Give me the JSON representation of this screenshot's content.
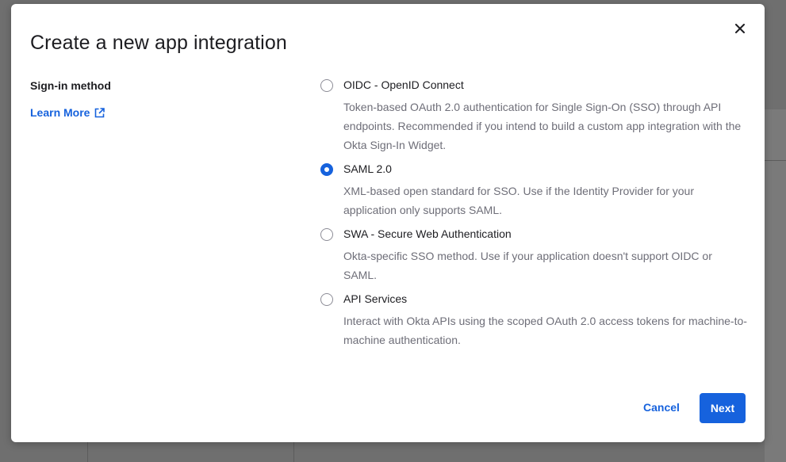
{
  "dialog": {
    "title": "Create a new app integration",
    "sign_in_label": "Sign-in method",
    "learn_more_label": "Learn More"
  },
  "options": [
    {
      "label": "OIDC - OpenID Connect",
      "description": "Token-based OAuth 2.0 authentication for Single Sign-On (SSO) through API endpoints. Recommended if you intend to build a custom app integration with the Okta Sign-In Widget.",
      "selected": false
    },
    {
      "label": "SAML 2.0",
      "description": "XML-based open standard for SSO. Use if the Identity Provider for your application only supports SAML.",
      "selected": true
    },
    {
      "label": "SWA - Secure Web Authentication",
      "description": "Okta-specific SSO method. Use if your application doesn't support OIDC or SAML.",
      "selected": false
    },
    {
      "label": "API Services",
      "description": "Interact with Okta APIs using the scoped OAuth 2.0 access tokens for machine-to-machine authentication.",
      "selected": false
    }
  ],
  "footer": {
    "cancel_label": "Cancel",
    "next_label": "Next"
  },
  "colors": {
    "accent": "#1662dd",
    "overlay": "#6f6f6f"
  }
}
